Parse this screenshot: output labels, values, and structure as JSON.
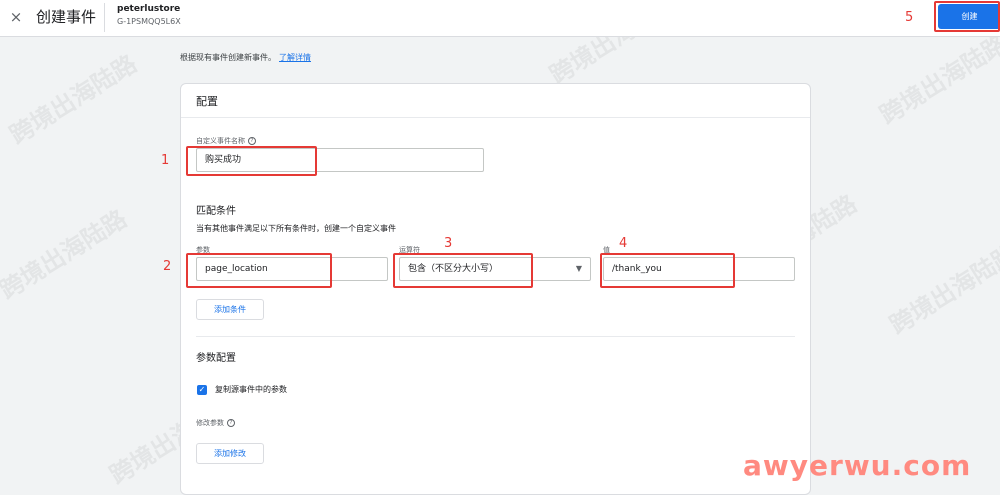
{
  "header": {
    "close_glyph": "×",
    "title": "创建事件",
    "property_name": "peterlustore",
    "property_id": "G-1PSMQQ5L6X",
    "create_label": "创建"
  },
  "intro": {
    "text": "根据现有事件创建新事件。",
    "link": "了解详情"
  },
  "config": {
    "title": "配置",
    "event_name_label": "自定义事件名称",
    "event_name_value": "购买成功"
  },
  "match": {
    "title": "匹配条件",
    "description": "当有其他事件满足以下所有条件时，创建一个自定义事件",
    "param_label": "参数",
    "param_value": "page_location",
    "operator_label": "运算符",
    "operator_value": "包含（不区分大小写）",
    "value_label": "值",
    "value_value": "/thank_you",
    "add_condition": "添加条件"
  },
  "params": {
    "title": "参数配置",
    "copy_label": "复制源事件中的参数",
    "copy_checked": true,
    "modify_label": "修改参数",
    "add_modify": "添加修改"
  },
  "annotations": [
    "1",
    "2",
    "3",
    "4",
    "5"
  ],
  "annotation_color": "#e53935",
  "watermark_text": "跨境出海陆路",
  "site_watermark": "awyerwu.com",
  "icons": {
    "close": "close-icon",
    "help": "help-icon",
    "dropdown": "arrow-drop-down-icon",
    "check": "check-icon"
  },
  "colors": {
    "accent": "#1a73e8",
    "background": "#f1f3f4",
    "card": "#ffffff"
  }
}
